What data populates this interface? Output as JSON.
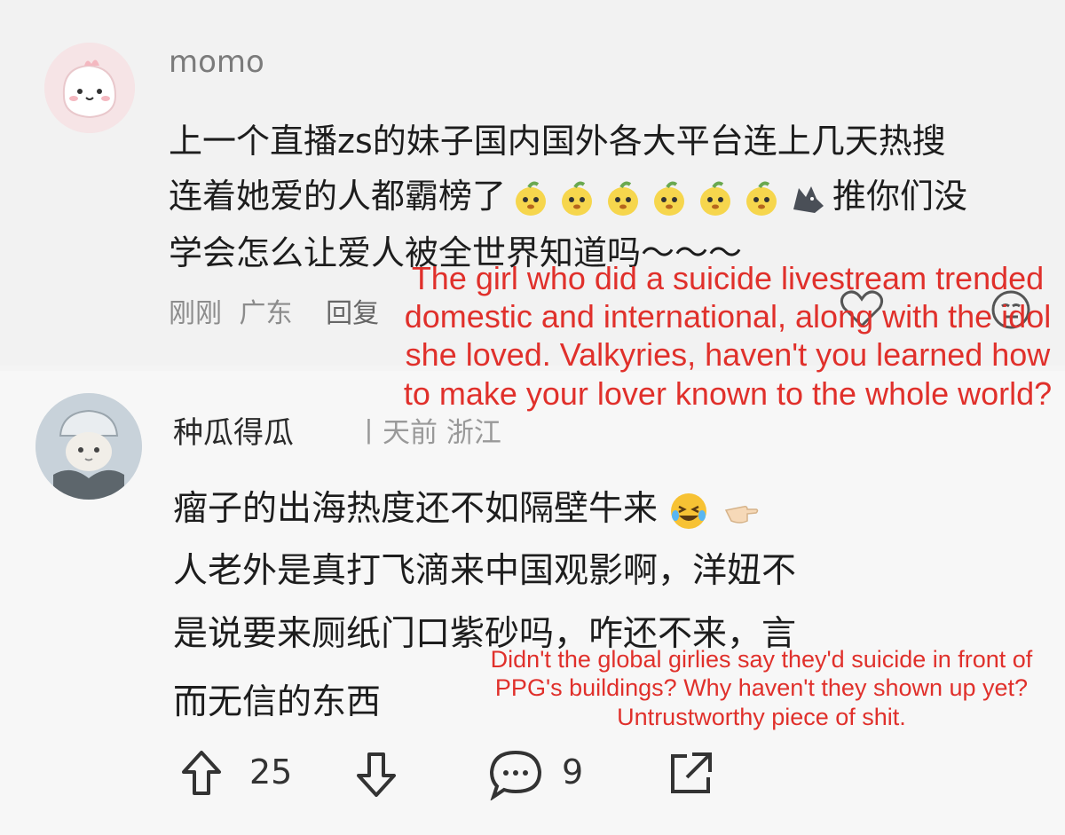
{
  "comment1": {
    "username": "momo",
    "lines": [
      "上一个直播zs的妹子国内国外各大平台连上几天热搜",
      "连着她爱的人都霸榜了",
      "推你们没",
      "学会怎么让爱人被全世界知道吗～～～"
    ],
    "meta": {
      "time": "刚刚",
      "location": "广东",
      "reply": "回复"
    }
  },
  "comment2": {
    "username": "种瓜得瓜",
    "meta_partial": "丨天前 浙江",
    "lines": [
      "瘤子的出海热度还不如隔壁牛来",
      "人老外是真打飞滴来中国观影啊，洋妞不",
      "是说要来厕纸门口紫砂吗，咋还不来，言",
      "而无信的东西"
    ],
    "upvotes": "25",
    "comments": "9"
  },
  "translations": {
    "first": "The girl who did a suicide livestream trended domestic and international, along with the idol she loved. Valkyries, haven't you learned how to make your lover known to the whole world?",
    "second": "Didn't the global girlies say they'd suicide in front of PPG's buildings? Why haven't they shown up yet? Untrustworthy piece of shit."
  },
  "colors": {
    "translation_text": "#e0302b",
    "meta_gray": "#8c8c8c"
  },
  "icons": [
    "avatar-image",
    "upvote-icon",
    "downvote-icon",
    "comment-icon",
    "share-icon",
    "like-heart-icon",
    "dislike-icon"
  ]
}
